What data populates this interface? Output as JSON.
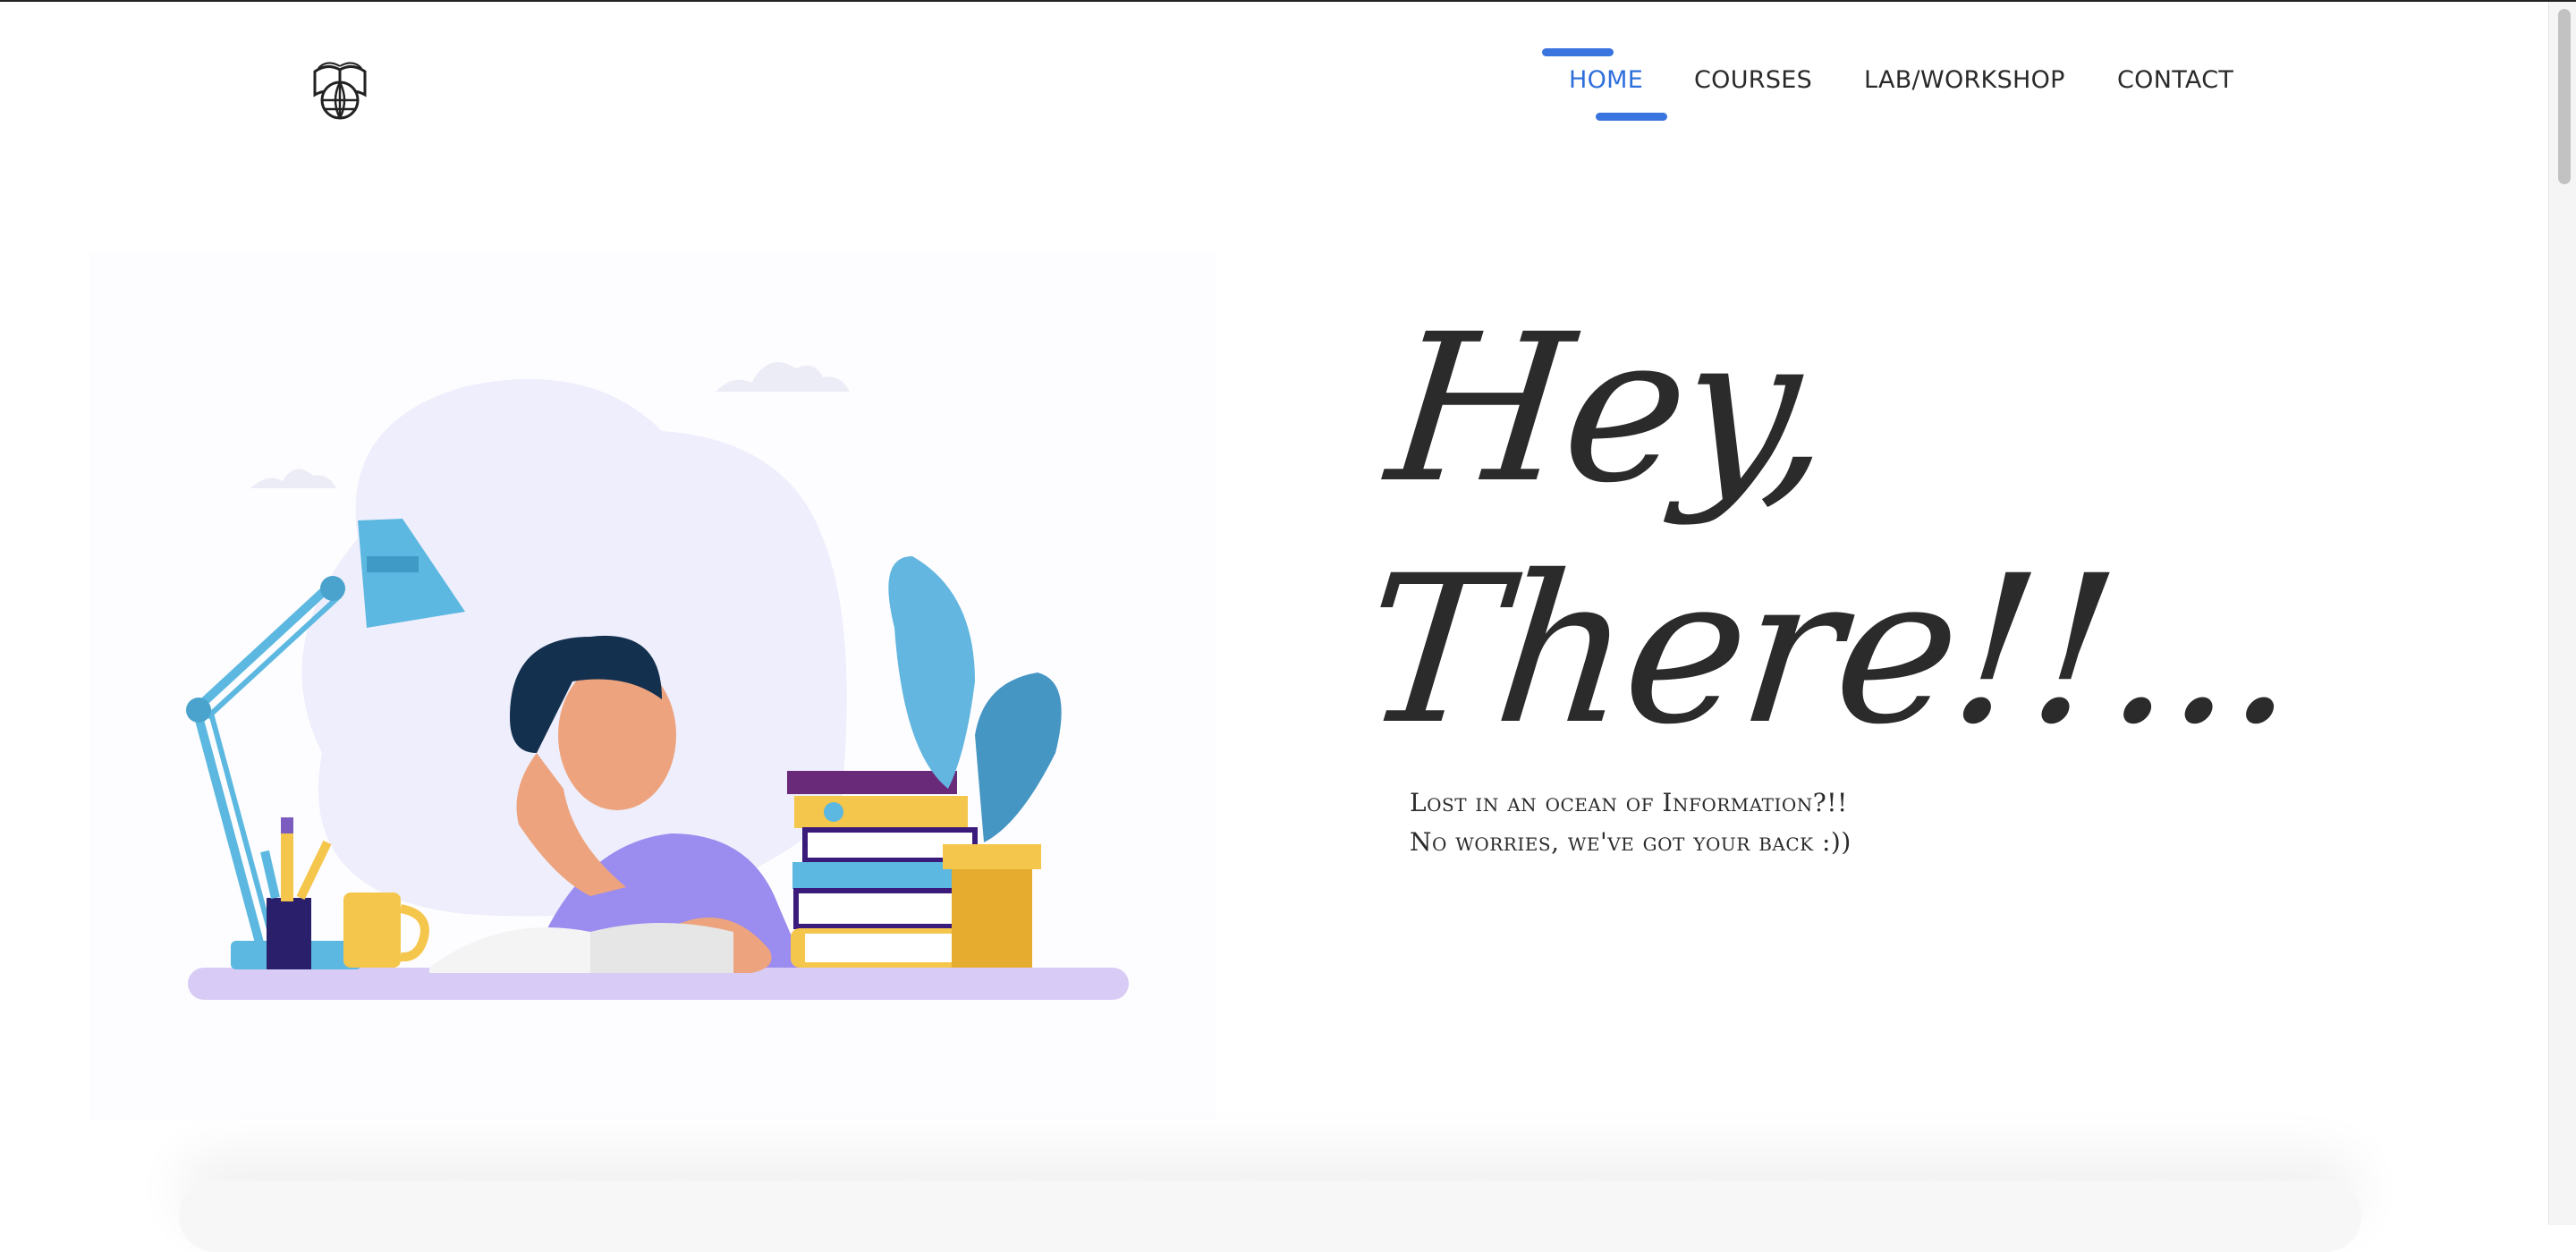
{
  "nav": {
    "items": [
      {
        "label": "HOME",
        "active": true
      },
      {
        "label": "COURSES",
        "active": false
      },
      {
        "label": "LAB/WORKSHOP",
        "active": false
      },
      {
        "label": "CONTACT",
        "active": false
      }
    ],
    "active_color": "#2f6fdc"
  },
  "logo": {
    "icon": "book-globe-icon"
  },
  "hero": {
    "heading_line1": "Hey,",
    "heading_line2": "There!!...",
    "sub_line1": "Lost in an ocean of Information?!!",
    "sub_line2": "No worries, we've got your back :))"
  },
  "illustration": {
    "icon": "student-reading-illustration"
  }
}
